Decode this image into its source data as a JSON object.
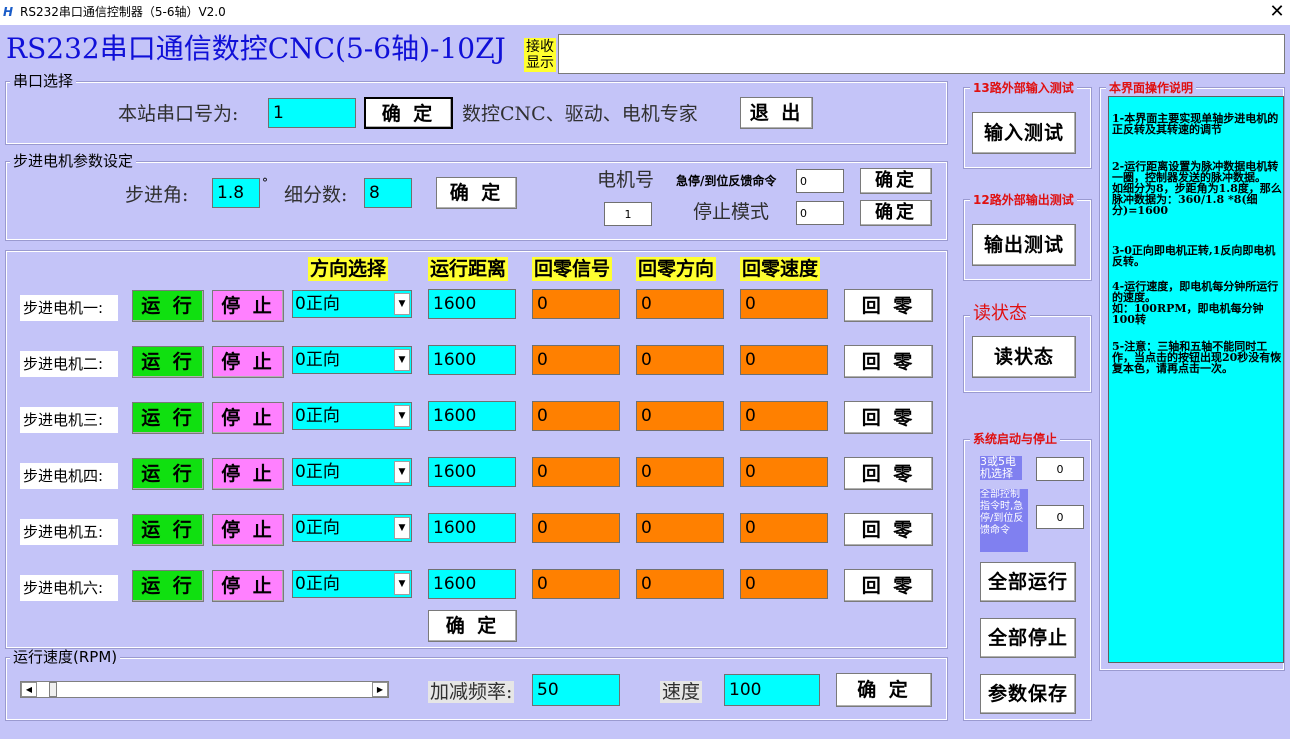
{
  "window": {
    "title": "RS232串口通信控制器（5-6轴）V2.0",
    "close": "✕"
  },
  "heading": "RS232串口通信数控CNC(5-6轴)-10ZJ",
  "receive_label": "接收\n显示",
  "receive_value": "",
  "serial": {
    "group": "串口选择",
    "port_label": "本站串口号为:",
    "port_value": "1",
    "confirm": "确 定",
    "slogan": "数控CNC、驱动、电机专家",
    "exit": "退 出"
  },
  "stepper": {
    "group": "步进电机参数设定",
    "angle_label": "步进角:",
    "angle_value": "1.8",
    "degree": "°",
    "subdiv_label": "细分数:",
    "subdiv_value": "8",
    "confirm": "确 定",
    "motor_no_label": "电机号",
    "motor_no_value": "1",
    "estop_label": "急停/到位反馈命令",
    "estop_value": "0",
    "estop_confirm": "确定",
    "stop_mode_label": "停止模式",
    "stop_mode_value": "0",
    "stop_mode_confirm": "确定"
  },
  "motors": {
    "headers": {
      "direction": "方向选择",
      "distance": "运行距离",
      "home_signal": "回零信号",
      "home_direction": "回零方向",
      "home_speed": "回零速度"
    },
    "run": "运 行",
    "stop": "停 止",
    "home": "回 零",
    "rows": [
      {
        "label": "步进电机一:",
        "direction": "0正向",
        "distance": "1600",
        "home_signal": "0",
        "home_direction": "0",
        "home_speed": "0"
      },
      {
        "label": "步进电机二:",
        "direction": "0正向",
        "distance": "1600",
        "home_signal": "0",
        "home_direction": "0",
        "home_speed": "0"
      },
      {
        "label": "步进电机三:",
        "direction": "0正向",
        "distance": "1600",
        "home_signal": "0",
        "home_direction": "0",
        "home_speed": "0"
      },
      {
        "label": "步进电机四:",
        "direction": "0正向",
        "distance": "1600",
        "home_signal": "0",
        "home_direction": "0",
        "home_speed": "0"
      },
      {
        "label": "步进电机五:",
        "direction": "0正向",
        "distance": "1600",
        "home_signal": "0",
        "home_direction": "0",
        "home_speed": "0"
      },
      {
        "label": "步进电机六:",
        "direction": "0正向",
        "distance": "1600",
        "home_signal": "0",
        "home_direction": "0",
        "home_speed": "0"
      }
    ],
    "confirm": "确 定"
  },
  "speed": {
    "group": "运行速度(RPM)",
    "accel_label": "加减频率:",
    "accel_value": "50",
    "speed_label": "速度",
    "speed_value": "100",
    "confirm": "确 定",
    "scroll_left": "◀",
    "scroll_right": "▶"
  },
  "input_test": {
    "group": "13路外部输入测试",
    "button": "输入测试"
  },
  "output_test": {
    "group": "12路外部输出测试",
    "button": "输出测试"
  },
  "read_status": {
    "group": "读状态",
    "button": "读状态"
  },
  "system": {
    "group": "系统启动与停止",
    "motor_select_label": "3或5电机选择",
    "motor_select_value": "0",
    "all_cmd_label": "全部控制指令时,急停/到位反馈命令",
    "all_cmd_value": "0",
    "run_all": "全部运行",
    "stop_all": "全部停止",
    "save": "参数保存"
  },
  "help": {
    "group": "本界面操作说明",
    "items": [
      "1-本界面主要实现单轴步进电机的正反转及其转速的调节",
      "2-运行距离设置为脉冲数据电机转一圈，控制器发送的脉冲数据。\n如细分为8，步距角为1.8度，那么脉冲数据为：360/1.8 *8(细分)=1600",
      "3-0正向即电机正转,1反向即电机反转。",
      "4-运行速度，即电机每分钟所运行的速度。\n如：100RPM，即电机每分钟100转",
      "5-注意：三轴和五轴不能同时工作，当点击的按钮出现20秒没有恢复本色，请再点击一次。"
    ]
  }
}
